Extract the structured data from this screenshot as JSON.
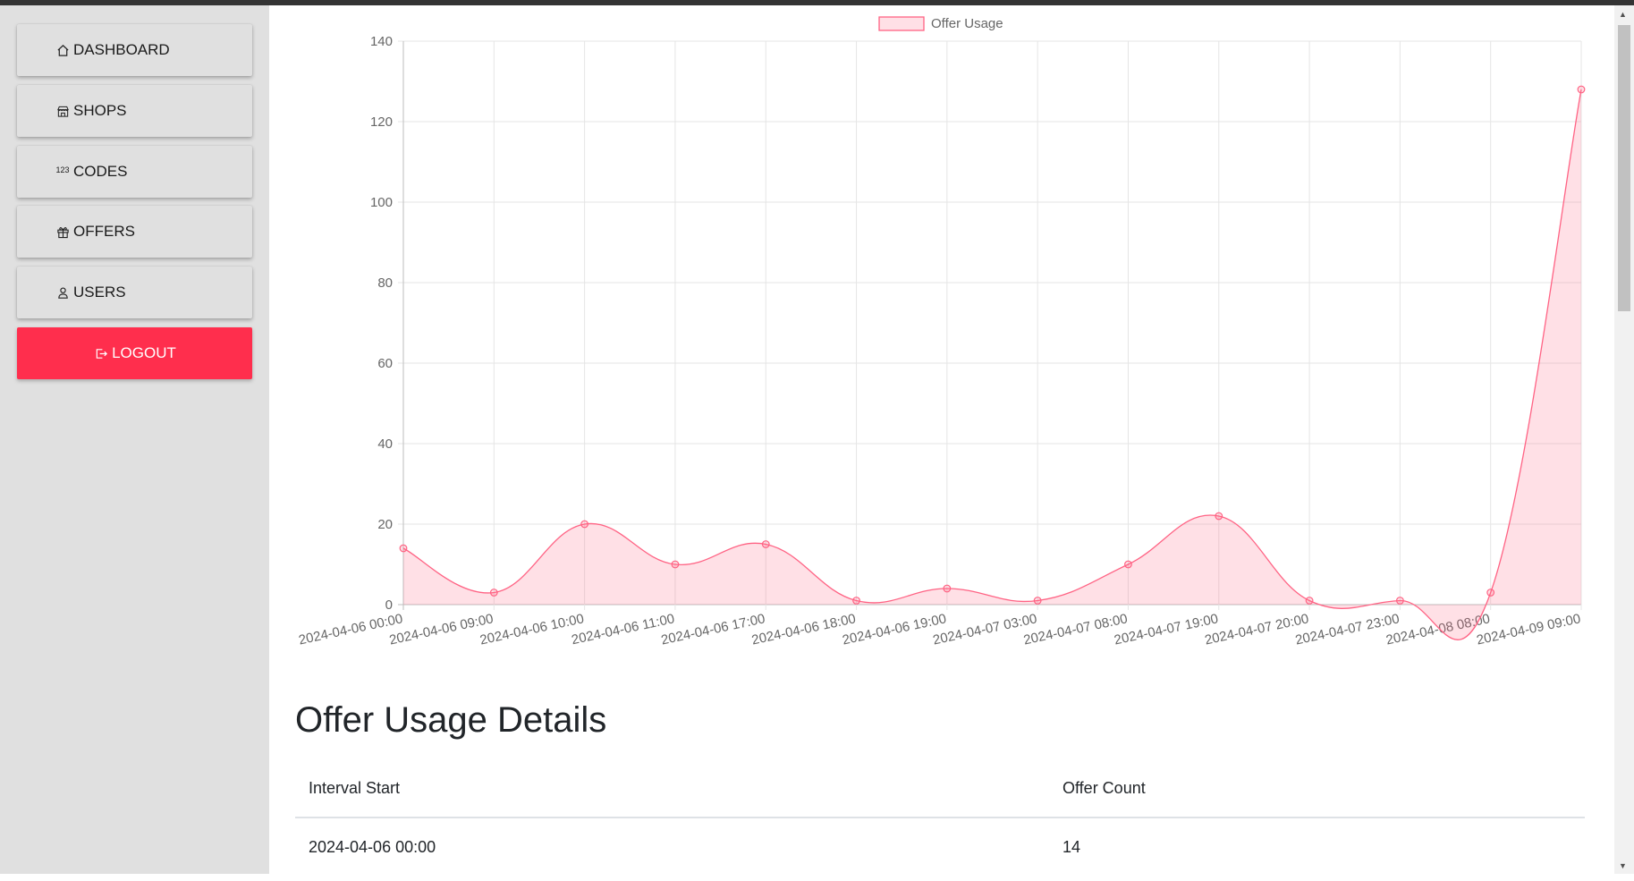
{
  "nav": {
    "items": [
      {
        "label": "DASHBOARD",
        "icon": "house-icon"
      },
      {
        "label": "SHOPS",
        "icon": "shop-icon"
      },
      {
        "label": "CODES",
        "icon": "numbers-123-icon"
      },
      {
        "label": "OFFERS",
        "icon": "gift-icon"
      },
      {
        "label": "USERS",
        "icon": "person-icon"
      }
    ],
    "logout_label": "LOGOUT",
    "logout_color": "#ff2e4d"
  },
  "chart_data": {
    "type": "area",
    "x": [
      "2024-04-06 00:00",
      "2024-04-06 09:00",
      "2024-04-06 10:00",
      "2024-04-06 11:00",
      "2024-04-06 17:00",
      "2024-04-06 18:00",
      "2024-04-06 19:00",
      "2024-04-07 03:00",
      "2024-04-07 08:00",
      "2024-04-07 19:00",
      "2024-04-07 20:00",
      "2024-04-07 23:00",
      "2024-04-08 08:00",
      "2024-04-09 09:00"
    ],
    "series": [
      {
        "name": "Offer Usage",
        "values": [
          14,
          3,
          20,
          10,
          15,
          1,
          4,
          1,
          10,
          22,
          1,
          1,
          3,
          128
        ],
        "color": "#ff6384"
      }
    ],
    "ylim": [
      0,
      140
    ],
    "yticks": [
      0,
      20,
      40,
      60,
      80,
      100,
      120,
      140
    ],
    "grid": true,
    "legend": "top-center"
  },
  "details": {
    "title": "Offer Usage Details",
    "columns": [
      "Interval Start",
      "Offer Count"
    ],
    "rows": [
      [
        "2024-04-06 00:00",
        "14"
      ]
    ]
  }
}
